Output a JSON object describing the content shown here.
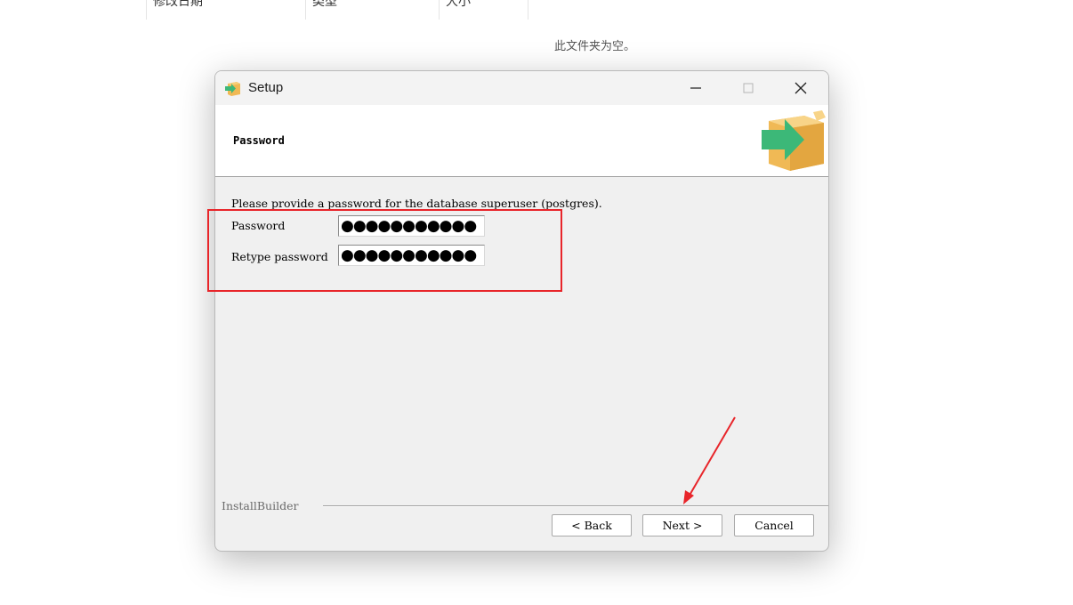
{
  "explorer": {
    "columns": [
      "修改日期",
      "类型",
      "大小"
    ],
    "empty_message": "此文件夹为空。"
  },
  "window": {
    "title": "Setup",
    "header_title": "Password",
    "prompt": "Please provide a password for the database superuser (postgres).",
    "fields": [
      {
        "label": "Password",
        "value": "●●●●●●●●●●●"
      },
      {
        "label": "Retype password",
        "value": "●●●●●●●●●●●"
      }
    ],
    "footer_brand": "InstallBuilder",
    "buttons": {
      "back": "< Back",
      "next": "Next >",
      "cancel": "Cancel"
    }
  },
  "colors": {
    "annotation": "#e8252a",
    "box_orange": "#f0b955",
    "arrow_green": "#3cb878"
  }
}
